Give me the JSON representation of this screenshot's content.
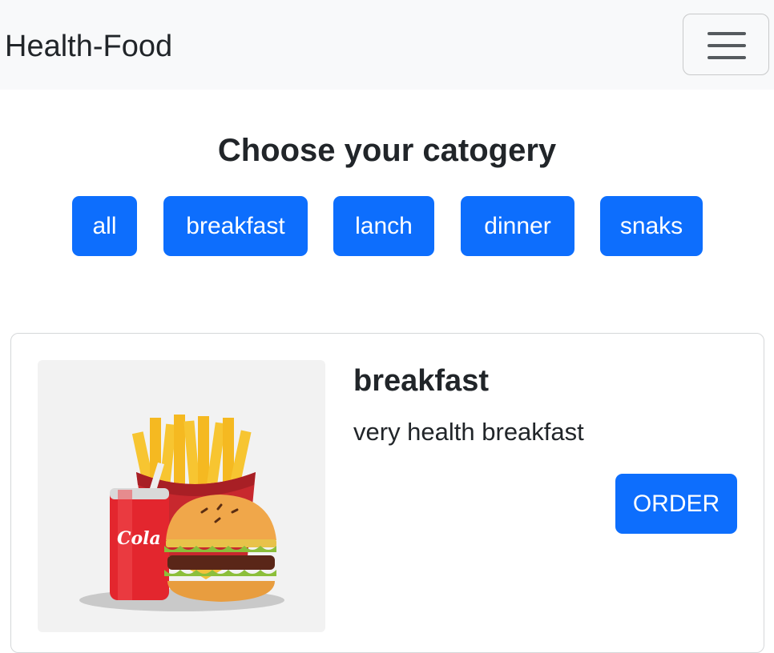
{
  "navbar": {
    "brand": "Health-Food",
    "toggler_icon": "hamburger-menu-icon"
  },
  "main": {
    "heading": "Choose your catogery",
    "categories": [
      {
        "label": "all"
      },
      {
        "label": "breakfast"
      },
      {
        "label": "lanch"
      },
      {
        "label": "dinner"
      },
      {
        "label": "snaks"
      }
    ]
  },
  "card": {
    "image_icon": "burger-fries-cola-illustration",
    "image_text": "Cola",
    "title": "breakfast",
    "text": "very health breakfast",
    "order_label": "ORDER"
  },
  "colors": {
    "primary": "#0d6efd",
    "navbar_bg": "#f8f9fa",
    "text": "#212529"
  }
}
